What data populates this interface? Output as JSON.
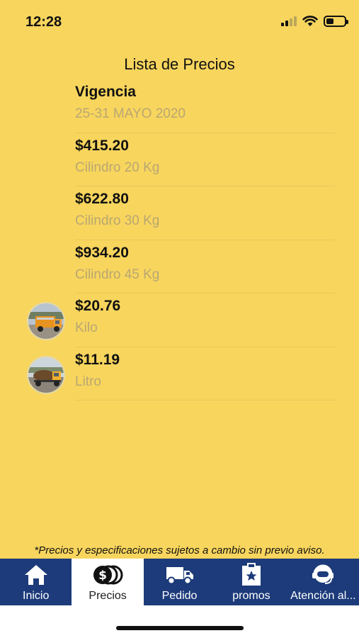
{
  "status": {
    "time": "12:28"
  },
  "title": "Lista de Precios",
  "items": [
    {
      "primary": "Vigencia",
      "secondary": "25-31 MAYO 2020",
      "thumb": null
    },
    {
      "primary": "$415.20",
      "secondary": "Cilindro 20 Kg",
      "thumb": null
    },
    {
      "primary": "$622.80",
      "secondary": "Cilindro 30 Kg",
      "thumb": null
    },
    {
      "primary": "$934.20",
      "secondary": "Cilindro 45 Kg",
      "thumb": null
    },
    {
      "primary": "$20.76",
      "secondary": "Kilo",
      "thumb": "truck-photo"
    },
    {
      "primary": "$11.19",
      "secondary": "Litro",
      "thumb": "tanker-photo"
    }
  ],
  "disclaimer": "*Precios y especificaciones sujetos a cambio sin previo aviso.",
  "tabs": [
    {
      "label": "Inicio",
      "icon": "home-icon",
      "active": false
    },
    {
      "label": "Precios",
      "icon": "coins-icon",
      "active": true
    },
    {
      "label": "Pedido",
      "icon": "truck-icon",
      "active": false
    },
    {
      "label": "promos",
      "icon": "star-badge-icon",
      "active": false
    },
    {
      "label": "Atención al...",
      "icon": "headset-icon",
      "active": false
    }
  ],
  "colors": {
    "background": "#f8d55d",
    "tabbar": "#1d3b7a",
    "secondary_text": "#b9a773"
  }
}
